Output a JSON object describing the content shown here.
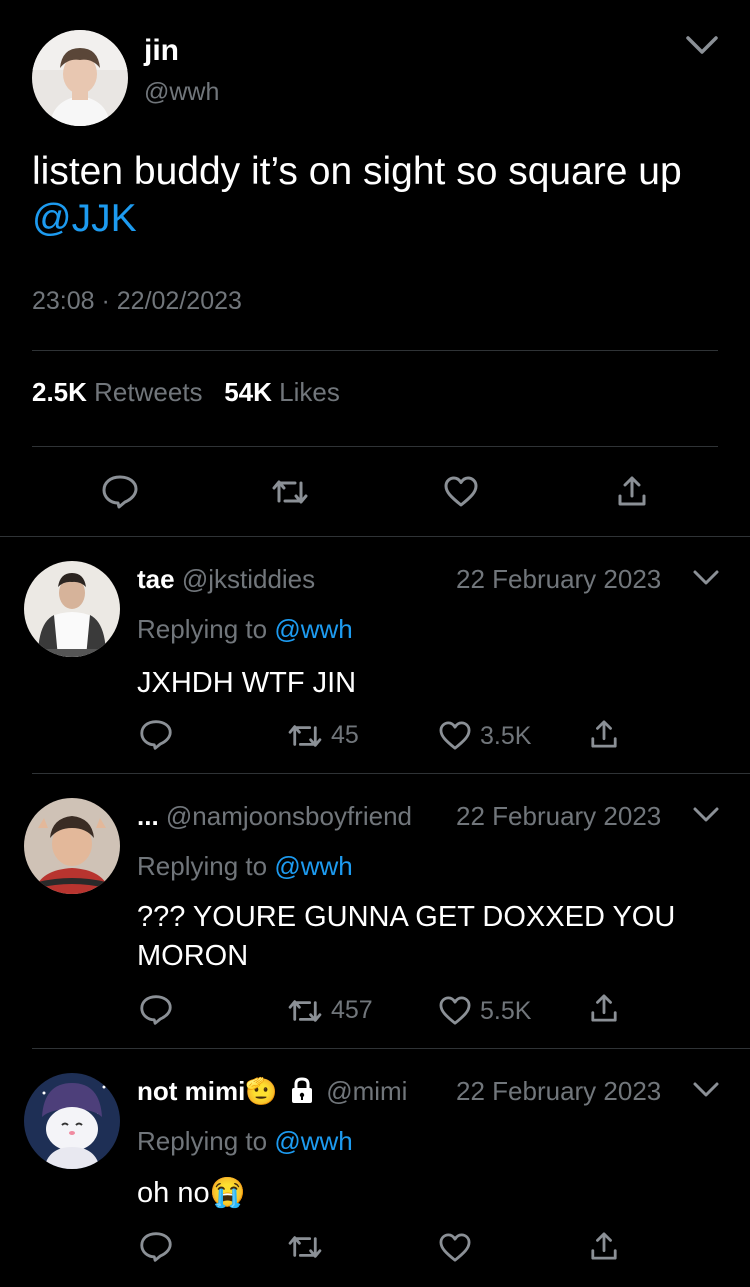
{
  "main_tweet": {
    "display_name": "jin",
    "handle": "@wwh",
    "text_plain": "listen buddy it’s on sight so square up ",
    "mention": "@JJK",
    "timestamp": "23:08 · 22/02/2023",
    "retweets_count": "2.5K",
    "retweets_label": "Retweets",
    "likes_count": "54K",
    "likes_label": "Likes",
    "icons": [
      "reply-icon",
      "retweet-icon",
      "like-icon",
      "share-icon"
    ]
  },
  "replies": [
    {
      "display_name": "tae",
      "handle": "@jkstiddies",
      "date": "22 February 2023",
      "replying_label": "Replying to",
      "replying_to": "@wwh",
      "text": "JXHDH WTF JIN",
      "retweets": "45",
      "likes": "3.5K"
    },
    {
      "display_name": "...",
      "handle": "@namjoonsboyfriend",
      "date": "22 February 2023",
      "replying_label": "Replying to",
      "replying_to": "@wwh",
      "text": "??? YOURE GUNNA GET DOXXED YOU MORON",
      "retweets": "457",
      "likes": "5.5K"
    },
    {
      "display_name": "not mimi",
      "name_emoji": "🫡",
      "lock_icon": "lock-icon",
      "handle": "@mimi",
      "date": "22 February 2023",
      "replying_label": "Replying to",
      "replying_to": "@wwh",
      "text": "oh no",
      "text_emoji": "😭",
      "retweets": "",
      "likes": ""
    }
  ],
  "colors": {
    "background": "#000000",
    "text": "#e7e9ea",
    "secondary": "#71767b",
    "accent": "#1d9bf0",
    "divider": "#2f3336"
  }
}
